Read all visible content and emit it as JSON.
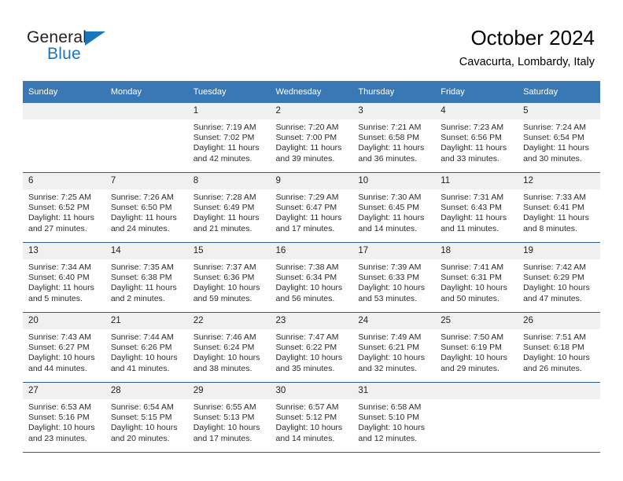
{
  "brand": {
    "name_part1": "General",
    "name_part2": "Blue",
    "triangle_color": "#1b75bb",
    "text_color": "#231f20"
  },
  "header": {
    "title": "October 2024",
    "subtitle": "Cavacurta, Lombardy, Italy"
  },
  "colors": {
    "header_band": "#3a78b5",
    "daynum_band": "#f0f0f0",
    "row_divider": "#2f5c8a",
    "body_text": "#2b2b2b"
  },
  "weekdays": [
    "Sunday",
    "Monday",
    "Tuesday",
    "Wednesday",
    "Thursday",
    "Friday",
    "Saturday"
  ],
  "weeks": [
    [
      {
        "day": "",
        "empty": true
      },
      {
        "day": "",
        "empty": true
      },
      {
        "day": "1",
        "sunrise": "Sunrise: 7:19 AM",
        "sunset": "Sunset: 7:02 PM",
        "daylight_1": "Daylight: 11 hours",
        "daylight_2": "and 42 minutes."
      },
      {
        "day": "2",
        "sunrise": "Sunrise: 7:20 AM",
        "sunset": "Sunset: 7:00 PM",
        "daylight_1": "Daylight: 11 hours",
        "daylight_2": "and 39 minutes."
      },
      {
        "day": "3",
        "sunrise": "Sunrise: 7:21 AM",
        "sunset": "Sunset: 6:58 PM",
        "daylight_1": "Daylight: 11 hours",
        "daylight_2": "and 36 minutes."
      },
      {
        "day": "4",
        "sunrise": "Sunrise: 7:23 AM",
        "sunset": "Sunset: 6:56 PM",
        "daylight_1": "Daylight: 11 hours",
        "daylight_2": "and 33 minutes."
      },
      {
        "day": "5",
        "sunrise": "Sunrise: 7:24 AM",
        "sunset": "Sunset: 6:54 PM",
        "daylight_1": "Daylight: 11 hours",
        "daylight_2": "and 30 minutes."
      }
    ],
    [
      {
        "day": "6",
        "sunrise": "Sunrise: 7:25 AM",
        "sunset": "Sunset: 6:52 PM",
        "daylight_1": "Daylight: 11 hours",
        "daylight_2": "and 27 minutes."
      },
      {
        "day": "7",
        "sunrise": "Sunrise: 7:26 AM",
        "sunset": "Sunset: 6:50 PM",
        "daylight_1": "Daylight: 11 hours",
        "daylight_2": "and 24 minutes."
      },
      {
        "day": "8",
        "sunrise": "Sunrise: 7:28 AM",
        "sunset": "Sunset: 6:49 PM",
        "daylight_1": "Daylight: 11 hours",
        "daylight_2": "and 21 minutes."
      },
      {
        "day": "9",
        "sunrise": "Sunrise: 7:29 AM",
        "sunset": "Sunset: 6:47 PM",
        "daylight_1": "Daylight: 11 hours",
        "daylight_2": "and 17 minutes."
      },
      {
        "day": "10",
        "sunrise": "Sunrise: 7:30 AM",
        "sunset": "Sunset: 6:45 PM",
        "daylight_1": "Daylight: 11 hours",
        "daylight_2": "and 14 minutes."
      },
      {
        "day": "11",
        "sunrise": "Sunrise: 7:31 AM",
        "sunset": "Sunset: 6:43 PM",
        "daylight_1": "Daylight: 11 hours",
        "daylight_2": "and 11 minutes."
      },
      {
        "day": "12",
        "sunrise": "Sunrise: 7:33 AM",
        "sunset": "Sunset: 6:41 PM",
        "daylight_1": "Daylight: 11 hours",
        "daylight_2": "and 8 minutes."
      }
    ],
    [
      {
        "day": "13",
        "sunrise": "Sunrise: 7:34 AM",
        "sunset": "Sunset: 6:40 PM",
        "daylight_1": "Daylight: 11 hours",
        "daylight_2": "and 5 minutes."
      },
      {
        "day": "14",
        "sunrise": "Sunrise: 7:35 AM",
        "sunset": "Sunset: 6:38 PM",
        "daylight_1": "Daylight: 11 hours",
        "daylight_2": "and 2 minutes."
      },
      {
        "day": "15",
        "sunrise": "Sunrise: 7:37 AM",
        "sunset": "Sunset: 6:36 PM",
        "daylight_1": "Daylight: 10 hours",
        "daylight_2": "and 59 minutes."
      },
      {
        "day": "16",
        "sunrise": "Sunrise: 7:38 AM",
        "sunset": "Sunset: 6:34 PM",
        "daylight_1": "Daylight: 10 hours",
        "daylight_2": "and 56 minutes."
      },
      {
        "day": "17",
        "sunrise": "Sunrise: 7:39 AM",
        "sunset": "Sunset: 6:33 PM",
        "daylight_1": "Daylight: 10 hours",
        "daylight_2": "and 53 minutes."
      },
      {
        "day": "18",
        "sunrise": "Sunrise: 7:41 AM",
        "sunset": "Sunset: 6:31 PM",
        "daylight_1": "Daylight: 10 hours",
        "daylight_2": "and 50 minutes."
      },
      {
        "day": "19",
        "sunrise": "Sunrise: 7:42 AM",
        "sunset": "Sunset: 6:29 PM",
        "daylight_1": "Daylight: 10 hours",
        "daylight_2": "and 47 minutes."
      }
    ],
    [
      {
        "day": "20",
        "sunrise": "Sunrise: 7:43 AM",
        "sunset": "Sunset: 6:27 PM",
        "daylight_1": "Daylight: 10 hours",
        "daylight_2": "and 44 minutes."
      },
      {
        "day": "21",
        "sunrise": "Sunrise: 7:44 AM",
        "sunset": "Sunset: 6:26 PM",
        "daylight_1": "Daylight: 10 hours",
        "daylight_2": "and 41 minutes."
      },
      {
        "day": "22",
        "sunrise": "Sunrise: 7:46 AM",
        "sunset": "Sunset: 6:24 PM",
        "daylight_1": "Daylight: 10 hours",
        "daylight_2": "and 38 minutes."
      },
      {
        "day": "23",
        "sunrise": "Sunrise: 7:47 AM",
        "sunset": "Sunset: 6:22 PM",
        "daylight_1": "Daylight: 10 hours",
        "daylight_2": "and 35 minutes."
      },
      {
        "day": "24",
        "sunrise": "Sunrise: 7:49 AM",
        "sunset": "Sunset: 6:21 PM",
        "daylight_1": "Daylight: 10 hours",
        "daylight_2": "and 32 minutes."
      },
      {
        "day": "25",
        "sunrise": "Sunrise: 7:50 AM",
        "sunset": "Sunset: 6:19 PM",
        "daylight_1": "Daylight: 10 hours",
        "daylight_2": "and 29 minutes."
      },
      {
        "day": "26",
        "sunrise": "Sunrise: 7:51 AM",
        "sunset": "Sunset: 6:18 PM",
        "daylight_1": "Daylight: 10 hours",
        "daylight_2": "and 26 minutes."
      }
    ],
    [
      {
        "day": "27",
        "sunrise": "Sunrise: 6:53 AM",
        "sunset": "Sunset: 5:16 PM",
        "daylight_1": "Daylight: 10 hours",
        "daylight_2": "and 23 minutes."
      },
      {
        "day": "28",
        "sunrise": "Sunrise: 6:54 AM",
        "sunset": "Sunset: 5:15 PM",
        "daylight_1": "Daylight: 10 hours",
        "daylight_2": "and 20 minutes."
      },
      {
        "day": "29",
        "sunrise": "Sunrise: 6:55 AM",
        "sunset": "Sunset: 5:13 PM",
        "daylight_1": "Daylight: 10 hours",
        "daylight_2": "and 17 minutes."
      },
      {
        "day": "30",
        "sunrise": "Sunrise: 6:57 AM",
        "sunset": "Sunset: 5:12 PM",
        "daylight_1": "Daylight: 10 hours",
        "daylight_2": "and 14 minutes."
      },
      {
        "day": "31",
        "sunrise": "Sunrise: 6:58 AM",
        "sunset": "Sunset: 5:10 PM",
        "daylight_1": "Daylight: 10 hours",
        "daylight_2": "and 12 minutes."
      },
      {
        "day": "",
        "empty": true
      },
      {
        "day": "",
        "empty": true
      }
    ]
  ]
}
